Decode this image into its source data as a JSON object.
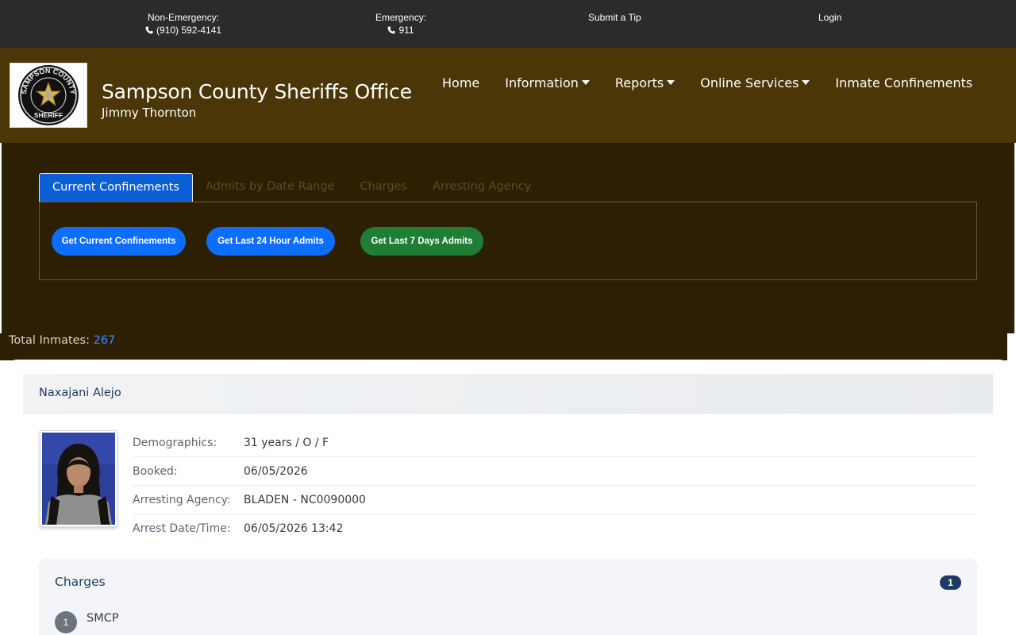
{
  "topbar": {
    "non_emergency_label": "Non-Emergency:",
    "non_emergency_phone": "(910) 592-4141",
    "emergency_label": "Emergency:",
    "emergency_phone": "911",
    "submit_tip": "Submit a Tip",
    "login": "Login"
  },
  "header": {
    "title": "Sampson County Sheriffs Office",
    "subtitle": "Jimmy Thornton",
    "logo_text_top": "SAMPSON COUNTY",
    "logo_text_bottom": "SHERIFF",
    "nav": [
      {
        "label": "Home",
        "dropdown": false
      },
      {
        "label": "Information",
        "dropdown": true
      },
      {
        "label": "Reports",
        "dropdown": true
      },
      {
        "label": "Online Services",
        "dropdown": true
      },
      {
        "label": "Inmate Confinements",
        "dropdown": false
      }
    ]
  },
  "tabs": [
    {
      "label": "Current Confinements",
      "active": true
    },
    {
      "label": "Admits by Date Range",
      "active": false
    },
    {
      "label": "Charges",
      "active": false
    },
    {
      "label": "Arresting Agency",
      "active": false
    }
  ],
  "buttons": {
    "current": "Get Current Confinements",
    "last24": "Get Last 24 Hour Admits",
    "last7": "Get Last 7 Days Admits"
  },
  "total": {
    "label": "Total Inmates:",
    "count": "267"
  },
  "inmate": {
    "name": "Naxajani Alejo",
    "fields": [
      {
        "key": "Demographics:",
        "value": "31 years / O / F"
      },
      {
        "key": "Booked:",
        "value": "06/05/2026"
      },
      {
        "key": "Arresting Agency:",
        "value": "BLADEN - NC0090000"
      },
      {
        "key": "Arrest Date/Time:",
        "value": "06/05/2026 13:42"
      }
    ],
    "charges_title": "Charges",
    "charges_count": "1",
    "charges": [
      {
        "num": "1",
        "code": "SMCP"
      }
    ]
  },
  "colors": {
    "topbar": "#2b2b2b",
    "header": "#4b3608",
    "dark_section": "#2d1f04",
    "primary_blue": "#0d6efd",
    "green": "#1e7e34"
  }
}
